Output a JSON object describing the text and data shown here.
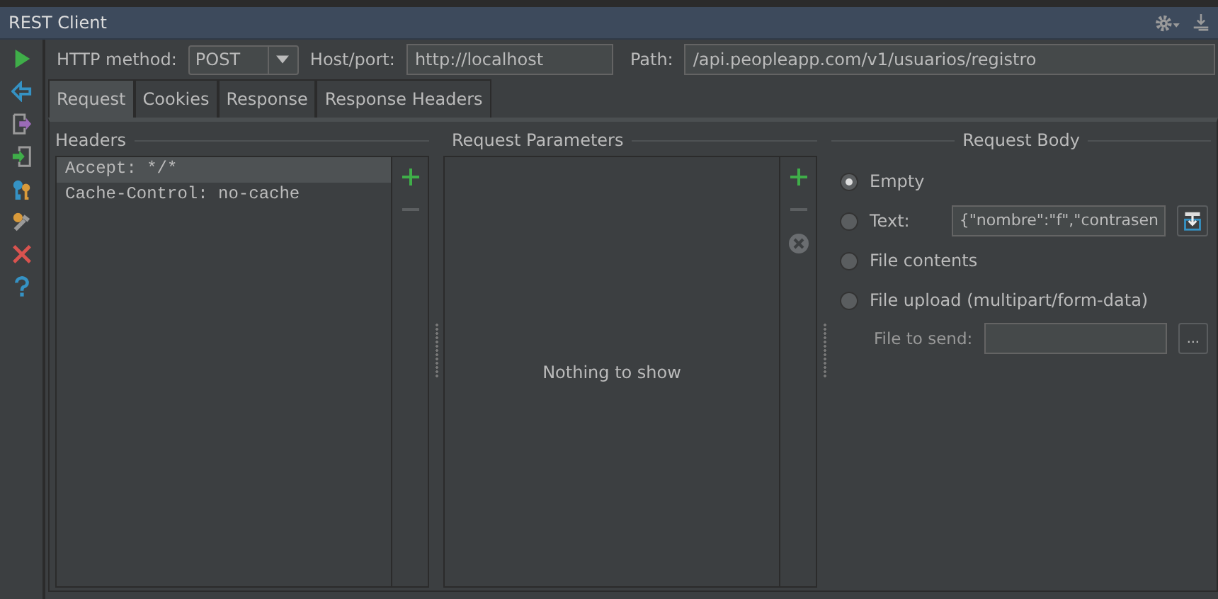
{
  "window": {
    "title": "REST Client"
  },
  "request": {
    "method_label": "HTTP method:",
    "method": "POST",
    "host_label": "Host/port:",
    "host": "http://localhost",
    "path_label": "Path:",
    "path": "/api.peopleapp.com/v1/usuarios/registro"
  },
  "tabs": [
    {
      "label": "Request",
      "selected": true
    },
    {
      "label": "Cookies",
      "selected": false
    },
    {
      "label": "Response",
      "selected": false
    },
    {
      "label": "Response Headers",
      "selected": false
    }
  ],
  "headers": {
    "title": "Headers",
    "rows": [
      {
        "text": "Accept: */*",
        "selected": true
      },
      {
        "text": "Cache-Control: no-cache",
        "selected": false
      }
    ]
  },
  "parameters": {
    "title": "Request Parameters",
    "empty_text": "Nothing to show"
  },
  "body": {
    "title": "Request Body",
    "options": [
      {
        "label": "Empty",
        "selected": true,
        "kind": "plain"
      },
      {
        "label": "Text:",
        "selected": false,
        "kind": "text",
        "value": "{\"nombre\":\"f\",\"contrasen"
      },
      {
        "label": "File contents",
        "selected": false,
        "kind": "plain"
      },
      {
        "label": "File upload (multipart/form-data)",
        "selected": false,
        "kind": "plain"
      }
    ],
    "file_label": "File to send:",
    "browse_label": "..."
  }
}
